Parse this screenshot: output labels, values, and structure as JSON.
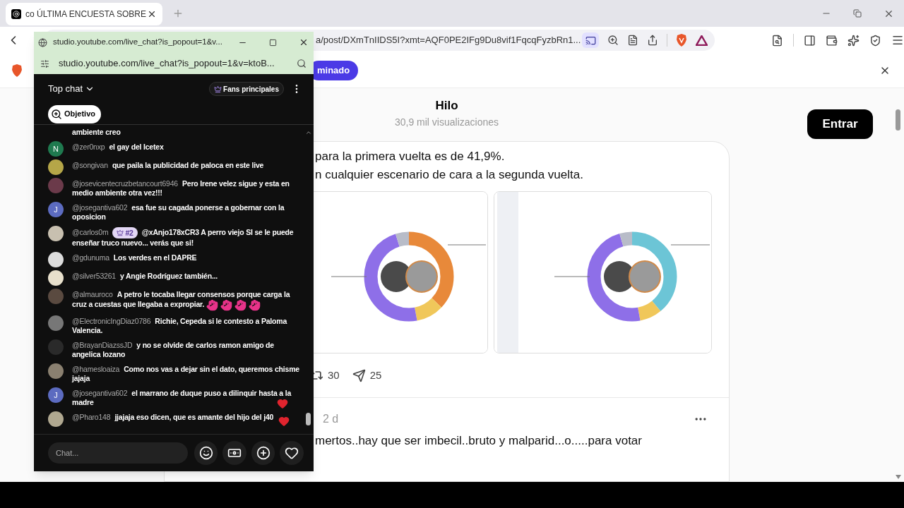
{
  "browser": {
    "tab": {
      "title": "co ÚLTIMA ENCUESTA SOBRE",
      "selected": true
    },
    "address": "a/post/DXmTnIIDS5I?xmt=AQF0PE2IFg9Du8vif1FqcqFyzbRn1...",
    "infobar_button": "minado"
  },
  "page": {
    "title": "Hilo",
    "views": "30,9 mil visualizaciones",
    "login_button": "Entrar",
    "post": {
      "lines": [
        "para la primera vuelta es de 41,9%.",
        "n cualquier escenario de cara a la segunda vuelta."
      ],
      "reposts": "30",
      "shares": "25"
    },
    "reply": {
      "time": "2 d",
      "text": "mertos..hay que ser imbecil..bruto y malparid...o.....para votar"
    }
  },
  "popup": {
    "title": "studio.youtube.com/live_chat?is_popout=1&v...",
    "address": "studio.youtube.com/live_chat?is_popout=1&v=ktoB...",
    "chat": {
      "mode": "Top chat",
      "fans_button": "Fans principales",
      "goal_chip": "Objetivo",
      "messages": [
        {
          "text": "ambiente creo"
        },
        {
          "author": "@zer0nxp",
          "text": "el gay del Icetex",
          "avatar": {
            "kind": "letter",
            "letter": "N",
            "color": "#1f7a4f"
          }
        },
        {
          "author": "@songivan",
          "text": "que paila la publicidad de paloca en este live"
        },
        {
          "author": "@josevicentecruzbetancourt6946",
          "text": "Pero Irene velez sigue y esta en medio ambiente otra vez!!!"
        },
        {
          "author": "@josegantiva602",
          "text": "esa fue su cagada ponerse a gobernar con la oposicion",
          "avatar": {
            "kind": "letter",
            "letter": "J",
            "color": "#5c6bc0"
          }
        },
        {
          "author": "@carlos0m",
          "badge": "#2",
          "text": "@xAnjo178xCR3 A perro viejo SI se le puede enseñar truco nuevo... verás que si!"
        },
        {
          "author": "@gdunuma",
          "text": "Los verdes en el DAPRE"
        },
        {
          "author": "@silver53261",
          "text": "y Angie Rodríguez también..."
        },
        {
          "author": "@almauroco",
          "text": "A petro le tocaba llegar consensos porque carga la cruz a cuestas que llegaba a expropiar.",
          "emojis": [
            {
              "kind": "hand"
            },
            {
              "kind": "hand"
            },
            {
              "kind": "hand"
            },
            {
              "kind": "hand"
            }
          ]
        },
        {
          "author": "@ElectronicIngDiaz0786",
          "text": "Richie, Cepeda si le contesto a Paloma Valencia."
        },
        {
          "author": "@BrayanDiazssJD",
          "text": "y no se olvide de carlos ramon amigo de angelica lozano"
        },
        {
          "author": "@hamesloaiza",
          "text": "Como nos vas a dejar sin el dato, queremos chisme jajaja"
        },
        {
          "author": "@josegantiva602",
          "text": "el marrano de duque puso a dilinquir hasta a la madre",
          "avatar": {
            "kind": "letter",
            "letter": "J",
            "color": "#5c6bc0"
          }
        },
        {
          "author": "@Pharo148",
          "text": "jjajaja eso dicen, que es amante del hijo del j40"
        }
      ],
      "floating_reactions": [
        {
          "kind": "heart"
        },
        {
          "kind": "heart"
        }
      ],
      "input": {
        "placeholder": "Chat..."
      }
    }
  }
}
